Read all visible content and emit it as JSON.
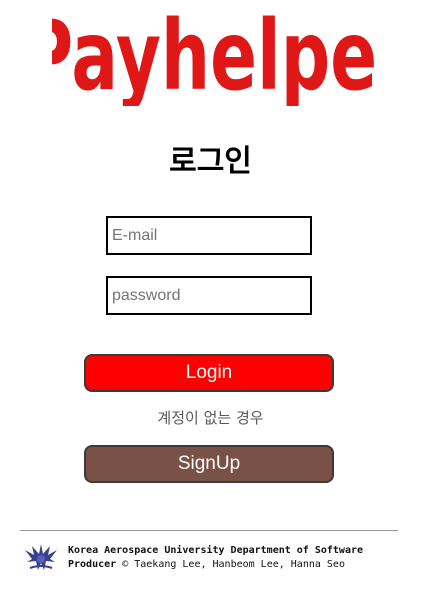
{
  "brand": {
    "logo_text": "Payhelper",
    "logo_color": "#e01717"
  },
  "login": {
    "title": "로그인",
    "email_placeholder": "E-mail",
    "password_placeholder": "password",
    "login_button": "Login",
    "no_account_text": "계정이 없는 경우",
    "signup_button": "SignUp"
  },
  "colors": {
    "login_button": "#ff0000",
    "signup_button": "#7a5147"
  },
  "footer": {
    "logo_icon": "university-emblem-icon",
    "line1": "Korea Aerospace University Department of Software",
    "producer_label": "Producer",
    "producer_names": "© Taekang Lee, Hanbeom Lee, Hanna Seo"
  }
}
